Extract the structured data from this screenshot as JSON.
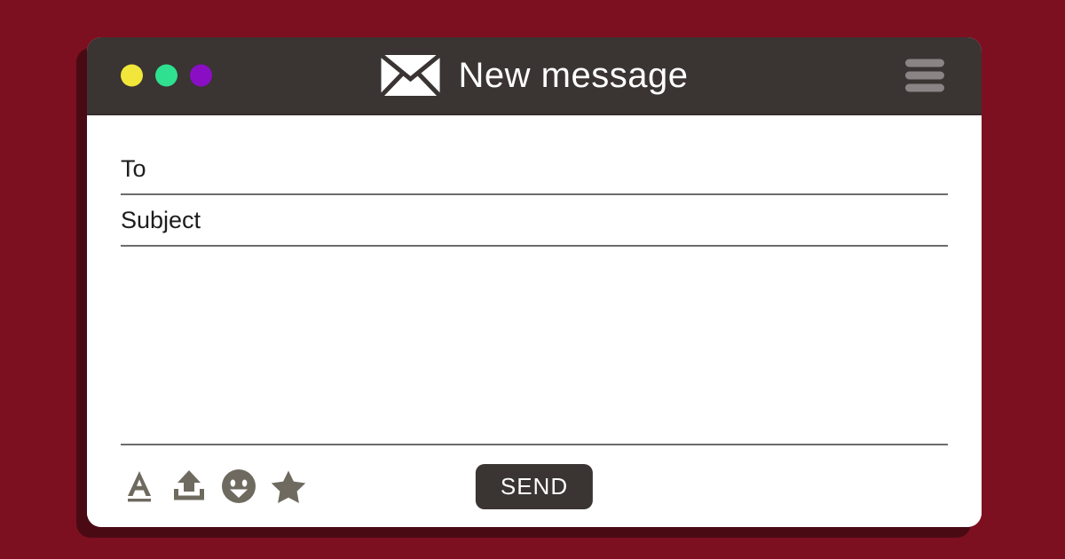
{
  "theme": {
    "page_background": "#7d1020",
    "window_shadow": "#4a0a14",
    "titlebar_background": "#3a3433",
    "window_background": "#ffffff",
    "field_line": "#6c6c6c",
    "icon_gray": "#6e6a5f",
    "hamburger_gray": "#8a8584",
    "send_button_background": "#3a3433",
    "send_button_text": "#ffffff"
  },
  "titlebar": {
    "title": "New message",
    "mail_icon": "envelope-icon",
    "menu_icon": "hamburger-menu-icon",
    "traffic_lights": [
      {
        "name": "window-dot-yellow",
        "color": "#f2e63a"
      },
      {
        "name": "window-dot-green",
        "color": "#2ee08f"
      },
      {
        "name": "window-dot-purple",
        "color": "#8a0fc4"
      }
    ]
  },
  "compose": {
    "to": {
      "label": "To",
      "value": "",
      "placeholder": "To"
    },
    "subject": {
      "label": "Subject",
      "value": "",
      "placeholder": "Subject"
    },
    "message_body": {
      "value": "",
      "placeholder": ""
    }
  },
  "toolbar": {
    "icons": [
      {
        "name": "text-format-icon",
        "label": "A"
      },
      {
        "name": "attach-upload-icon",
        "label": ""
      },
      {
        "name": "emoji-smiley-icon",
        "label": ""
      },
      {
        "name": "star-icon",
        "label": ""
      }
    ],
    "send_label": "SEND"
  }
}
